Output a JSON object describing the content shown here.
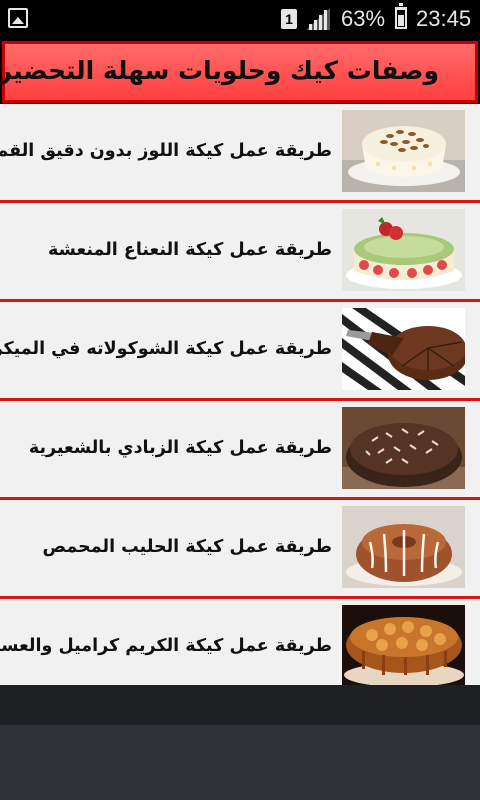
{
  "status_bar": {
    "sim_slot": "1",
    "battery_percent": "63%",
    "battery_level": 0.63,
    "time": "23:45",
    "icons": [
      "gallery-notification-icon",
      "sim-icon",
      "signal-icon",
      "battery-icon"
    ]
  },
  "header": {
    "title": "وصفات كيك وحلويات سهلة التحضير",
    "colors": {
      "background": "#ff4d4d",
      "border": "#c40000"
    }
  },
  "recipes": [
    {
      "label": "طريقة عمل كيكة اللوز بدون دقيق القمح",
      "thumbnail": "almond-cake-image"
    },
    {
      "label": "طريقة عمل كيكة النعناع المنعشة",
      "thumbnail": "mint-cake-image"
    },
    {
      "label": "طريقة عمل كيكة الشوكولاته في الميكرووي",
      "thumbnail": "chocolate-cake-image"
    },
    {
      "label": "طريقة عمل كيكة الزبادي بالشعيرية",
      "thumbnail": "yogurt-cake-image"
    },
    {
      "label": "طريقة عمل كيكة الحليب المحمص",
      "thumbnail": "toasted-milk-cake-image"
    },
    {
      "label": "طريقة عمل كيكة الكريم كراميل والعسل",
      "thumbnail": "caramel-honey-cake-image"
    }
  ],
  "colors": {
    "divider": "#d81414",
    "list_background": "#f1f1f1"
  }
}
